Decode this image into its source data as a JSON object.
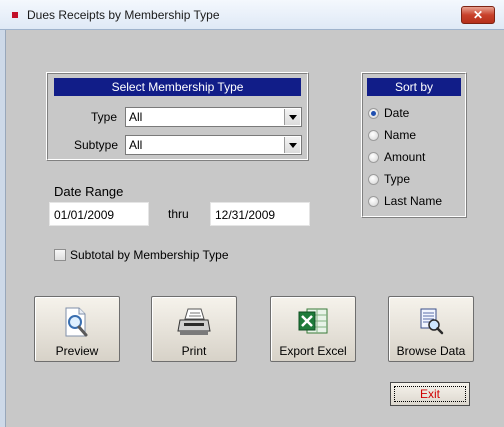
{
  "window": {
    "title": "Dues Receipts by Membership Type",
    "close_glyph": "✕"
  },
  "membership": {
    "header": "Select Membership Type",
    "type_label": "Type",
    "type_value": "All",
    "subtype_label": "Subtype",
    "subtype_value": "All"
  },
  "sort": {
    "header": "Sort by",
    "options": [
      {
        "label": "Date",
        "checked": true
      },
      {
        "label": "Name",
        "checked": false
      },
      {
        "label": "Amount",
        "checked": false
      },
      {
        "label": "Type",
        "checked": false
      },
      {
        "label": "Last Name",
        "checked": false
      }
    ]
  },
  "date_range": {
    "label": "Date Range",
    "from": "01/01/2009",
    "thru_label": "thru",
    "to": "12/31/2009"
  },
  "subtotal": {
    "label": "Subtotal by Membership Type",
    "checked": false
  },
  "buttons": {
    "preview": "Preview",
    "print": "Print",
    "export_excel": "Export Excel",
    "browse_data": "Browse Data",
    "exit": "Exit"
  },
  "colors": {
    "group_header": "#111d88",
    "exit_text": "#d10000",
    "title_icon": "#c2102a"
  }
}
